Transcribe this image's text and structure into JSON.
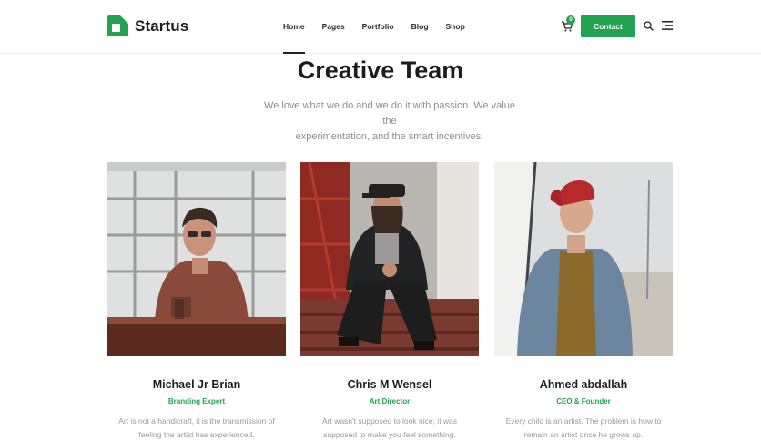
{
  "brand": {
    "name": "Startus",
    "accent": "#22a352"
  },
  "nav": {
    "items": [
      "Home",
      "Pages",
      "Portfolio",
      "Blog",
      "Shop"
    ],
    "active": "Home"
  },
  "header": {
    "cart_count": "0",
    "contact_label": "Contact",
    "icons": [
      "cart-icon",
      "search-icon",
      "menu-icon"
    ]
  },
  "hero": {
    "title": "Creative Team",
    "subtitle_line1": "We love what we do and we do it with passion. We value the",
    "subtitle_line2": "experimentation, and the smart incentives."
  },
  "team": [
    {
      "name": "Michael Jr Brian",
      "role": "Branding Expert",
      "bio_line1": "Art is not a handicraft, it is the transmission of",
      "bio_line2": "feeling the artist has experienced."
    },
    {
      "name": "Chris M Wensel",
      "role": "Art Director",
      "bio_line1": "Art wasn't supposed to look nice; it was",
      "bio_line2": "supposed to make you feel something."
    },
    {
      "name": "Ahmed abdallah",
      "role": "CEO & Founder",
      "bio_line1": "Every child is an artist. The problem is how to",
      "bio_line2": "remain an artist once he grows up."
    }
  ]
}
